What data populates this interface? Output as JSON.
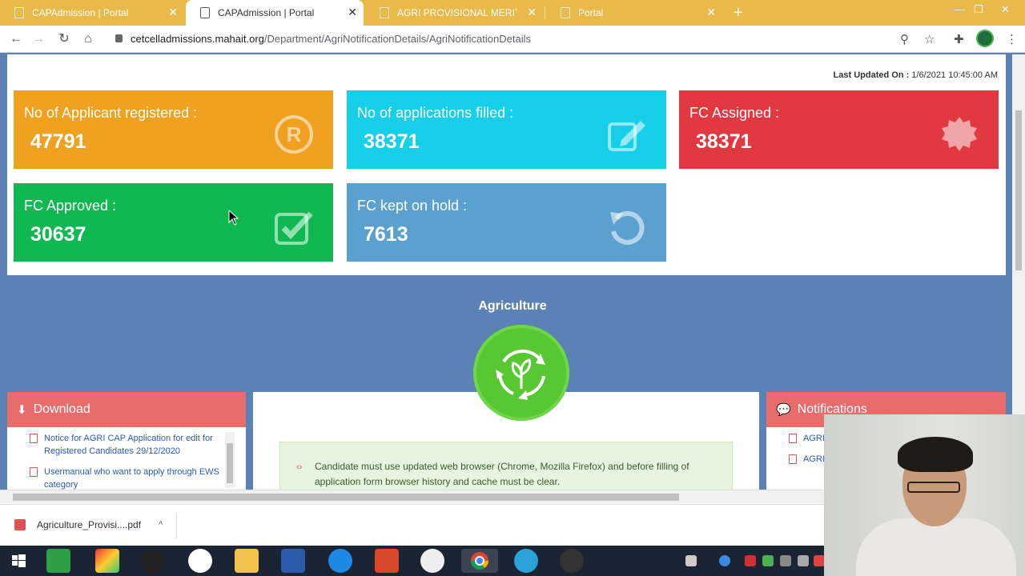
{
  "browser": {
    "tabs": [
      {
        "title": "CAPAdmission | Portal",
        "active": false
      },
      {
        "title": "CAPAdmission | Portal",
        "active": true
      },
      {
        "title": "AGRI PROVISIONAL MERIT LIST C",
        "active": false
      },
      {
        "title": "Portal",
        "active": false
      }
    ],
    "url_host": "cetcelladmissions.mahait.org",
    "url_path": "/Department/AgriNotificationDetails/AgriNotificationDetails"
  },
  "page": {
    "last_updated_label": "Last Updated On :",
    "last_updated_value": "1/6/2021 10:45:00 AM",
    "cards": [
      {
        "title": "No of Applicant registered :",
        "value": "47791",
        "color": "#f0a11f",
        "icon": "registered-icon"
      },
      {
        "title": "No of applications filled :",
        "value": "38371",
        "color": "#16cfe8",
        "icon": "edit-icon"
      },
      {
        "title": "FC Assigned :",
        "value": "38371",
        "color": "#e2383f",
        "icon": "badge-icon"
      },
      {
        "title": "FC Approved :",
        "value": "30637",
        "color": "#0fb851",
        "icon": "checkbox-icon"
      },
      {
        "title": "FC kept on hold :",
        "value": "7613",
        "color": "#5aa1cf",
        "icon": "refresh-icon"
      }
    ],
    "section_title": "Agriculture",
    "download": {
      "heading": "Download",
      "items": [
        "Notice for AGRI CAP Application for edit for Registered Candidates 29/12/2020",
        "Usermanual who want to apply through EWS category"
      ]
    },
    "notice": "Candidate must use updated web browser (Chrome, Mozilla Firefox) and before filling of application form browser history and cache must be clear.",
    "notifications": {
      "heading": "Notifications",
      "items": [
        "AGRI_",
        "AGRI_"
      ]
    }
  },
  "download_bar": {
    "filename": "Agriculture_Provisi....pdf"
  }
}
